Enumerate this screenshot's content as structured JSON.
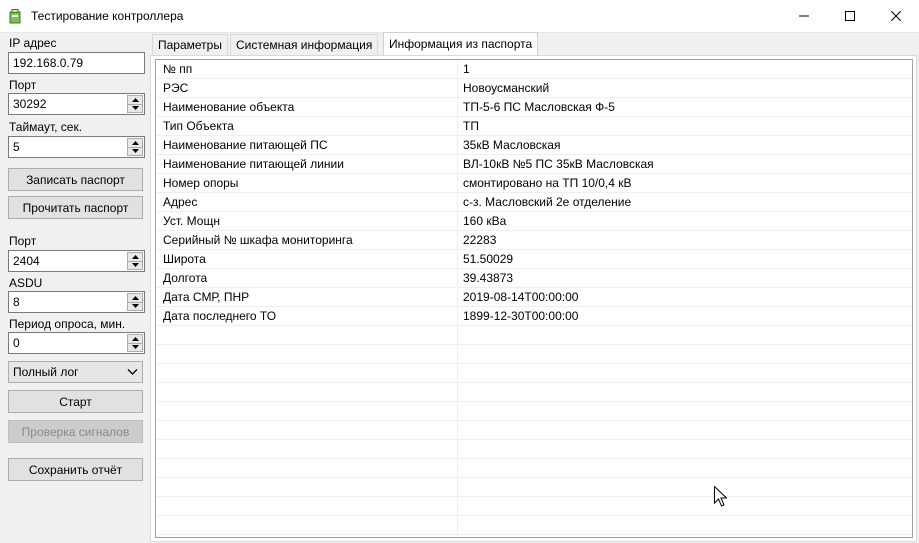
{
  "window": {
    "title": "Тестирование контроллера",
    "minimize_glyph": "—",
    "maximize_glyph": "☐",
    "close_glyph": "✕"
  },
  "connection": {
    "ip_label": "IP адрес",
    "ip_value": "192.168.0.79",
    "port_label": "Порт",
    "port_value": "30292",
    "timeout_label": "Таймаут, сек.",
    "timeout_value": "5",
    "write_passport_button": "Записать паспорт",
    "read_passport_button": "Прочитать паспорт"
  },
  "polling": {
    "port_label": "Порт",
    "port_value": "2404",
    "asdu_label": "ASDU",
    "asdu_value": "8",
    "period_label": "Период опроса, мин.",
    "period_value": "0",
    "log_mode_selected": "Полный лог",
    "start_button": "Старт",
    "check_signals_button": "Проверка сигналов",
    "save_report_button": "Сохранить отчёт"
  },
  "tabs": [
    {
      "label": "Параметры",
      "active": false
    },
    {
      "label": "Системная информация",
      "active": false
    },
    {
      "label": "Информация из паспорта",
      "active": true
    }
  ],
  "passport": {
    "rows": [
      {
        "name": "№ пп",
        "value": "1"
      },
      {
        "name": "РЭС",
        "value": "Новоусманский"
      },
      {
        "name": "Наименование объекта",
        "value": "ТП-5-6 ПС Масловская Ф-5"
      },
      {
        "name": "Тип Объекта",
        "value": "ТП"
      },
      {
        "name": "Наименование питающей ПС",
        "value": "35кВ Масловская"
      },
      {
        "name": "Наименование питающей линии",
        "value": "ВЛ-10кВ №5 ПС 35кВ Масловская"
      },
      {
        "name": "Номер опоры",
        "value": "смонтировано на ТП 10/0,4 кВ"
      },
      {
        "name": "Адрес",
        "value": "с-з. Масловский 2е отделение"
      },
      {
        "name": "Уст. Мощн",
        "value": "160 кВа"
      },
      {
        "name": "Серийный № шкафа мониторинга",
        "value": "22283"
      },
      {
        "name": "Широта",
        "value": "51.50029"
      },
      {
        "name": "Долгота",
        "value": "39.43873"
      },
      {
        "name": "Дата СМР, ПНР",
        "value": "2019-08-14T00:00:00"
      },
      {
        "name": "Дата последнего ТО",
        "value": "1899-12-30T00:00:00"
      },
      {
        "name": "",
        "value": ""
      },
      {
        "name": "",
        "value": ""
      },
      {
        "name": "",
        "value": ""
      },
      {
        "name": "",
        "value": ""
      },
      {
        "name": "",
        "value": ""
      },
      {
        "name": "",
        "value": ""
      },
      {
        "name": "",
        "value": ""
      },
      {
        "name": "",
        "value": ""
      },
      {
        "name": "",
        "value": ""
      },
      {
        "name": "",
        "value": ""
      },
      {
        "name": "",
        "value": ""
      }
    ]
  },
  "colors": {
    "window_bg": "#f0f0f0",
    "titlebar_bg": "#ffffff",
    "button_bg": "#e1e1e1",
    "app_icon": "#6aa84f"
  },
  "icons": {
    "app": "app-icon",
    "spin_up": "chevron-up-icon",
    "spin_down": "chevron-down-icon",
    "combo": "chevron-down-icon",
    "cursor": "mouse-pointer-icon"
  }
}
